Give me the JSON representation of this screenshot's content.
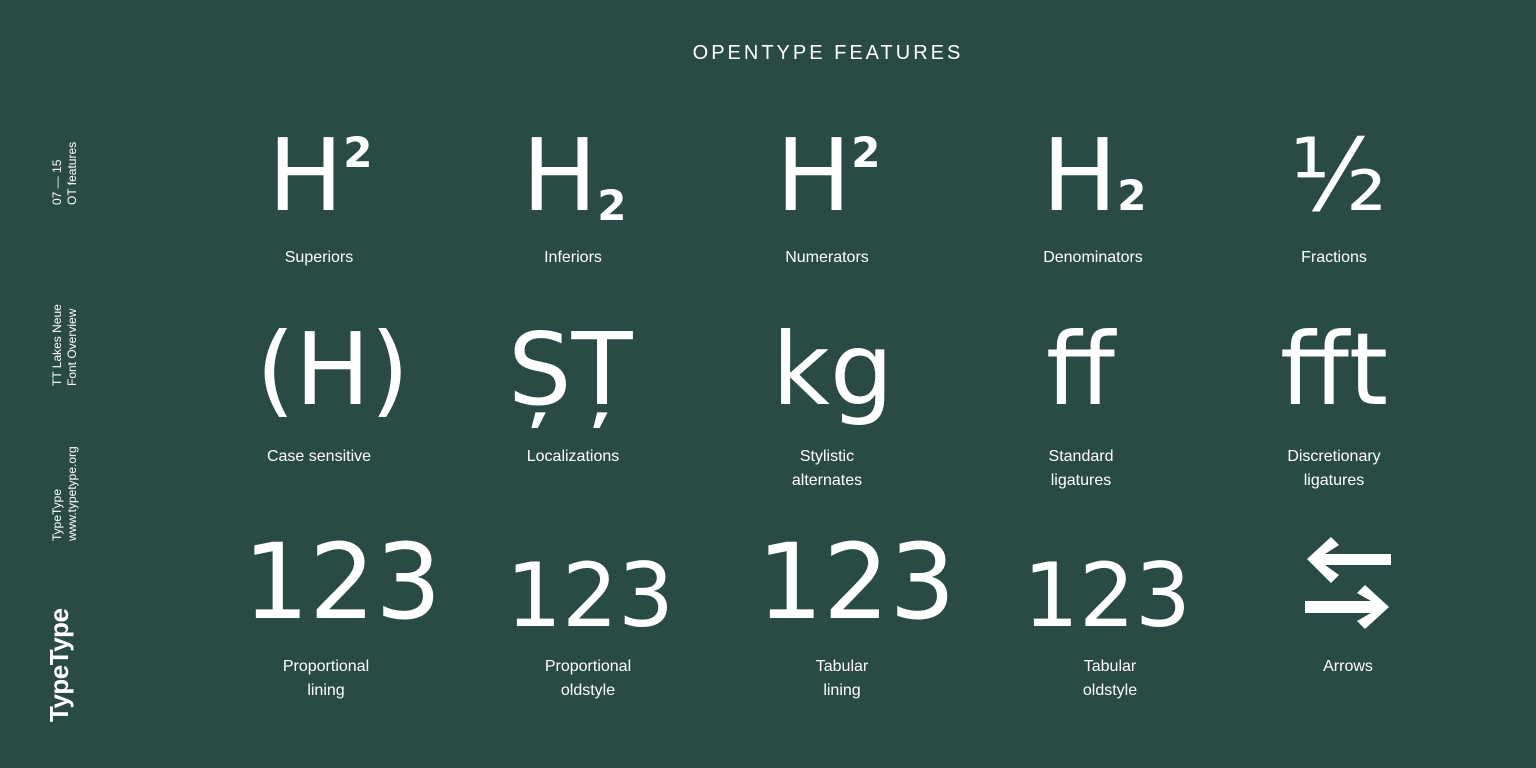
{
  "title": "OPENTYPE FEATURES",
  "sidebar": {
    "page_line1": "07 — 15",
    "page_line2": "OT features",
    "font_line1": "TT Lakes Neue",
    "font_line2": "Font Overview",
    "brand_line1": "TypeType",
    "brand_line2": "www.typetype.org",
    "logo": "TypeType"
  },
  "features": {
    "superiors": {
      "glyph": "H",
      "mark": "2",
      "label": "Superiors"
    },
    "inferiors": {
      "glyph": "H",
      "mark": "2",
      "label": "Inferiors"
    },
    "numerators": {
      "glyph": "H",
      "mark": "2",
      "label": "Numerators"
    },
    "denominators": {
      "glyph": "H",
      "mark": "2",
      "label": "Denominators"
    },
    "fractions": {
      "glyph": "½",
      "label": "Fractions"
    },
    "case_sensitive": {
      "glyph": "(H)",
      "label": "Case sensitive"
    },
    "localizations": {
      "glyph": "ȘȚ",
      "label": "Localizations"
    },
    "stylistic": {
      "glyph": "kg",
      "label_line1": "Stylistic",
      "label_line2": "alternates"
    },
    "standard_ligatures": {
      "glyph": "ff",
      "label_line1": "Standard",
      "label_line2": "ligatures"
    },
    "discretionary_ligatures": {
      "glyph": "fft",
      "label_line1": "Discretionary",
      "label_line2": "ligatures"
    },
    "proportional_lining": {
      "glyph": "123",
      "label_line1": "Proportional",
      "label_line2": "lining"
    },
    "proportional_oldstyle": {
      "glyph": "123",
      "label_line1": "Proportional",
      "label_line2": "oldstyle"
    },
    "tabular_lining": {
      "glyph": "123",
      "label_line1": "Tabular",
      "label_line2": "lining"
    },
    "tabular_oldstyle": {
      "glyph": "123",
      "label_line1": "Tabular",
      "label_line2": "oldstyle"
    },
    "arrows": {
      "glyph": "arrows-icon",
      "label": "Arrows"
    }
  },
  "colors": {
    "background": "#2a4a46",
    "foreground": "#ffffff"
  }
}
